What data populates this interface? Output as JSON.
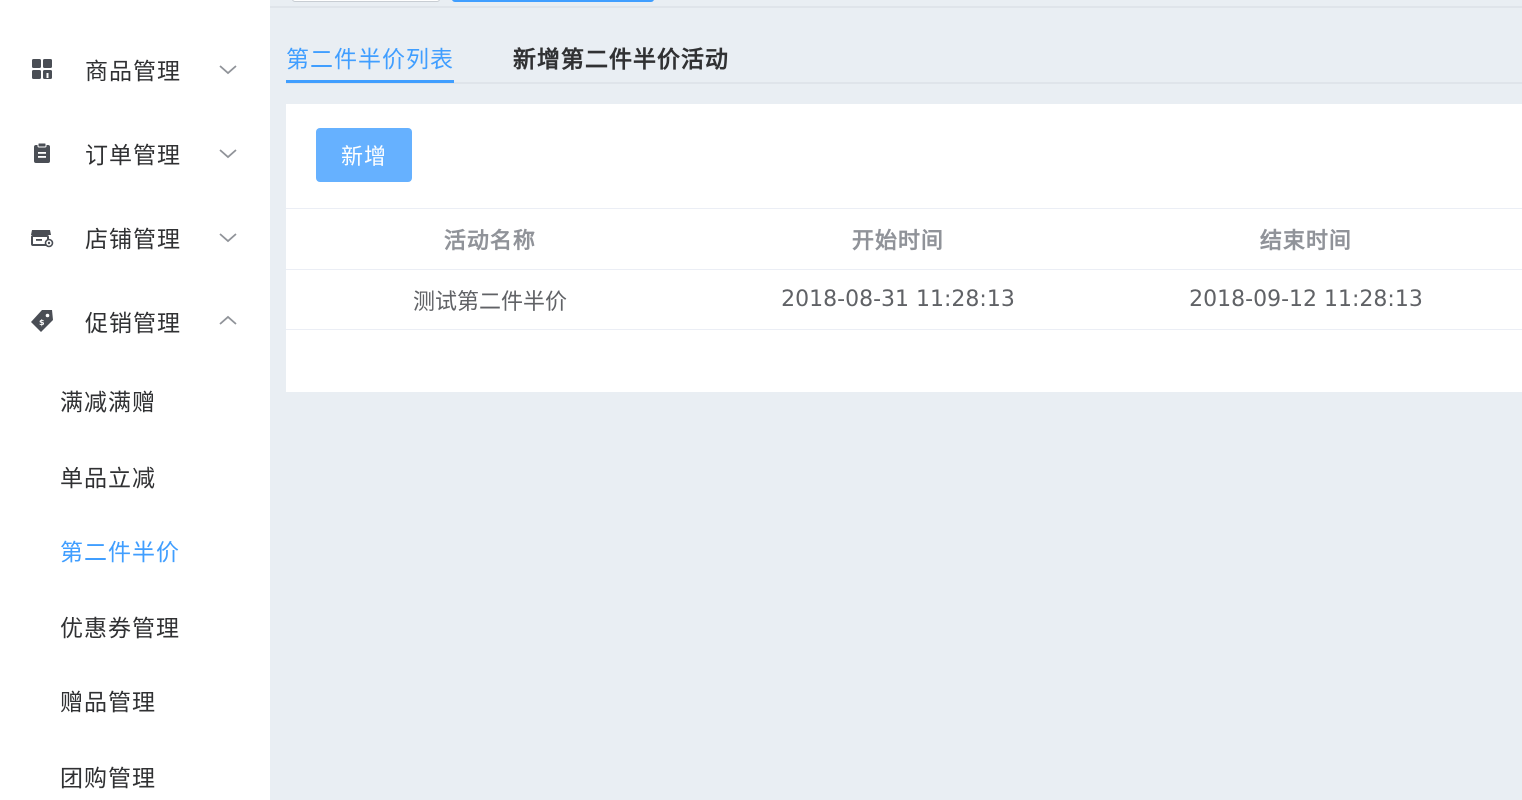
{
  "sidebar": {
    "groups": [
      {
        "label": "商品管理",
        "icon": "grid-icon",
        "expanded": false
      },
      {
        "label": "订单管理",
        "icon": "clipboard-icon",
        "expanded": false
      },
      {
        "label": "店铺管理",
        "icon": "store-icon",
        "expanded": false
      },
      {
        "label": "促销管理",
        "icon": "price-tag-icon",
        "expanded": true
      }
    ],
    "promo_items": [
      {
        "label": "满减满赠",
        "active": false
      },
      {
        "label": "单品立减",
        "active": false
      },
      {
        "label": "第二件半价",
        "active": true
      },
      {
        "label": "优惠券管理",
        "active": false
      },
      {
        "label": "赠品管理",
        "active": false
      },
      {
        "label": "团购管理",
        "active": false
      }
    ]
  },
  "tabs": [
    {
      "label": "第二件半价列表",
      "active": true
    },
    {
      "label": "新增第二件半价活动",
      "active": false
    }
  ],
  "toolbar": {
    "add_label": "新增"
  },
  "table": {
    "columns": [
      "活动名称",
      "开始时间",
      "结束时间"
    ],
    "rows": [
      {
        "name": "测试第二件半价",
        "start": "2018-08-31 11:28:13",
        "end": "2018-09-12 11:28:13"
      }
    ]
  },
  "colors": {
    "accent": "#409EFF",
    "button": "#66b1ff",
    "main_bg": "#e9eef3",
    "text": "#303133",
    "header_text": "#909399"
  }
}
